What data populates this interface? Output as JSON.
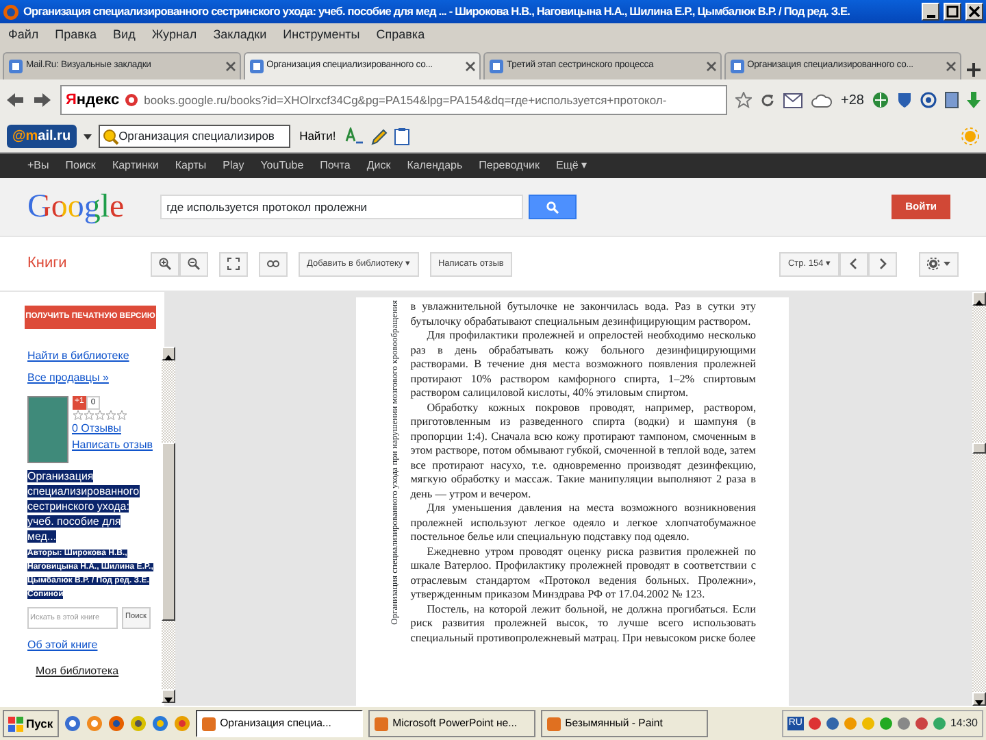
{
  "window": {
    "title": "Организация специализированного сестринского ухода: учеб. пособие для мед ... - Широкова Н.В., Наговицына Н.А., Шилина Е.Р., Цымбалюк В.Р. / Под ред. З.Е."
  },
  "menu": [
    "Файл",
    "Правка",
    "Вид",
    "Журнал",
    "Закладки",
    "Инструменты",
    "Справка"
  ],
  "tabs": [
    {
      "label": "Mail.Ru: Визуальные закладки",
      "selected": false
    },
    {
      "label": "Организация специализированного со...",
      "selected": true
    },
    {
      "label": "Третий этап сестринского процесса",
      "selected": false
    },
    {
      "label": "Организация специализированного со...",
      "selected": false
    }
  ],
  "nav": {
    "logo": "Яндекс",
    "url": "books.google.ru/books?id=XHOlrxcf34Cg&pg=PA154&lpg=PA154&dq=где+используется+протокол-",
    "weather": "+28"
  },
  "mail_toolbar": {
    "logo": "@mail.ru",
    "search_value": "Организация специализиров",
    "find_button": "Найти!"
  },
  "google_bar": [
    "+Вы",
    "Поиск",
    "Картинки",
    "Карты",
    "Play",
    "YouTube",
    "Почта",
    "Диск",
    "Календарь",
    "Переводчик",
    "Ещё ▾"
  ],
  "google_header": {
    "logo": "Google",
    "search_value": "где используется протокол пролежни",
    "signin": "Войти"
  },
  "books_toolbar": {
    "label": "Книги",
    "add_button": "Добавить в библиотеку ▾",
    "review_button": "Написать отзыв",
    "page_button": "Стр. 154 ▾"
  },
  "sidebar": {
    "buy_button": "ПОЛУЧИТЬ ПЕЧАТНУЮ ВЕРСИЮ",
    "links": [
      "Найти в библиотеке",
      "Все продавцы »"
    ],
    "plus_button": "+1",
    "plus_count": "0",
    "stars": 0,
    "reviews": "0 Отзывы",
    "write_review": "Написать отзыв",
    "book_title": "Организация специализированного сестринского ухода: учеб. пособие для мед...",
    "authors": "Авторы: Широкова Н.В., Наговицына Н.А., Шилина Е.Р., Цымбалюк В.Р. / Под ред. З.Е. Сопиной",
    "highlighted": true,
    "search_placeholder": "Искать в этой книге",
    "search_button": "Поиск",
    "about": "Об этой книге",
    "my_library": "Моя библиотека"
  },
  "page": {
    "margin_text": "Организация специализированного ухода при нарушении мозгового кровообращения",
    "paragraphs": [
      {
        "text": "в увлажнительной бутылочке не закончилась вода. Раз в сутки эту бутылочку обрабатывают специальным дезинфицирующим раствором.",
        "indent": false
      },
      {
        "text": "Для профилактики пролежней и опрелостей необходимо несколько раз в день обрабатывать кожу больного дезинфицирующими растворами. В течение дня места возможного появления пролежней протирают 10% раствором камфорного спирта, 1–2% спиртовым раствором салициловой кислоты, 40% этиловым спиртом.",
        "indent": true
      },
      {
        "text": "Обработку кожных покровов проводят, например, раствором, приготовленным из разведенного спирта (водки) и шампуня (в пропорции 1:4). Сначала всю кожу протирают тампоном, смоченным в этом растворе, потом обмывают губкой, смоченной в теплой воде, затем все протирают насухо, т.е. одновременно производят дезинфекцию, мягкую обработку и массаж. Такие манипуляции выполняют 2 раза в день — утром и вечером.",
        "indent": true
      },
      {
        "text": "Для уменьшения давления на места возможного возникновения пролежней используют легкое одеяло и легкое хлопчатобумажное постельное белье или специальную подставку под одеяло.",
        "indent": true
      },
      {
        "text": "Ежедневно утром проводят оценку риска развития пролежней по шкале Ватерлоо. Профилактику пролежней проводят в соответствии с отраслевым стандартом «Протокол ведения больных. Пролежни», утвержденным приказом Минздрава РФ от 17.04.2002 № 123.",
        "indent": true
      },
      {
        "text": "Постель, на которой лежит больной, не должна прогибаться. Если риск развития пролежней высок, то лучше всего использовать специальный противопролежневый матрац. При невысоком риске более",
        "indent": true
      }
    ]
  },
  "taskbar": {
    "start": "Пуск",
    "tasks": [
      {
        "label": "Организация специа...",
        "selected": true
      },
      {
        "label": "Microsoft PowerPoint не...",
        "selected": false
      },
      {
        "label": "Безымянный - Paint",
        "selected": false
      }
    ],
    "lang": "RU",
    "clock": "14:30"
  }
}
